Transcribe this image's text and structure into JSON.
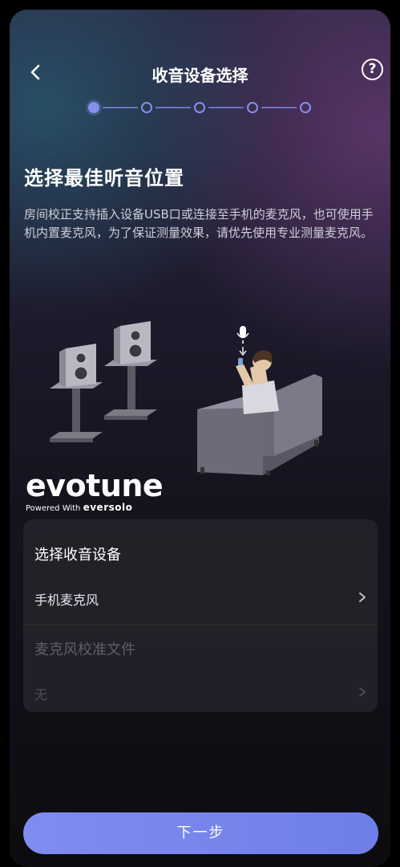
{
  "header": {
    "title": "收音设备选择",
    "help_glyph": "?",
    "back_icon": "chevron-left-icon"
  },
  "stepper": {
    "total": 5,
    "current": 1
  },
  "main": {
    "heading": "选择最佳听音位置",
    "description": "房间校正支持插入设备USB口或连接至手机的麦克风，也可使用手机内置麦克风，为了保证测量效果，请优先使用专业测量麦克风。"
  },
  "brand": {
    "logo": "evotune",
    "powered_prefix": "Powered With",
    "powered_brand": "eversolo"
  },
  "card": {
    "device_title": "选择收音设备",
    "device_value": "手机麦克风",
    "calibration_title": "麦克风校准文件",
    "calibration_value": "无"
  },
  "footer": {
    "next_label": "下一步"
  },
  "colors": {
    "accent": "#7f8cf0",
    "card_bg": "#24242c"
  }
}
